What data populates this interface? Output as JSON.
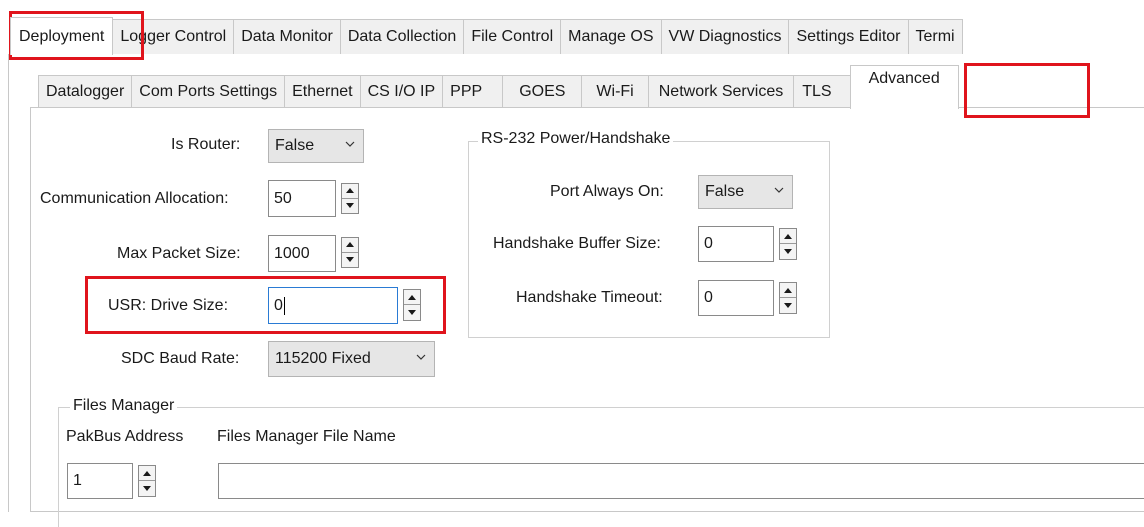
{
  "main_tabs": [
    "Deployment",
    "Logger Control",
    "Data Monitor",
    "Data Collection",
    "File Control",
    "Manage OS",
    "VW Diagnostics",
    "Settings Editor",
    "Termi"
  ],
  "sub_tabs": [
    "Datalogger",
    "Com Ports Settings",
    "Ethernet",
    "CS I/O IP",
    "PPP",
    "GOES",
    "Wi-Fi",
    "Network Services",
    "TLS",
    "Advanced"
  ],
  "fields": {
    "is_router": {
      "label": "Is Router:",
      "value": "False"
    },
    "comm_alloc": {
      "label": "Communication Allocation:",
      "value": "50"
    },
    "max_packet": {
      "label": "Max Packet Size:",
      "value": "1000"
    },
    "usr_drive": {
      "label": "USR: Drive Size:",
      "value": "0"
    },
    "sdc_baud": {
      "label": "SDC Baud Rate:",
      "value": "115200 Fixed"
    }
  },
  "rs232": {
    "title": "RS-232 Power/Handshake",
    "port_always_on": {
      "label": "Port Always On:",
      "value": "False"
    },
    "handshake_buffer": {
      "label": "Handshake Buffer Size:",
      "value": "0"
    },
    "handshake_timeout": {
      "label": "Handshake Timeout:",
      "value": "0"
    }
  },
  "files_manager": {
    "title": "Files Manager",
    "col_pakbus": "PakBus Address",
    "col_filename": "Files Manager File Name",
    "pakbus_value": "1",
    "filename_value": ""
  },
  "colors": {
    "highlight": "#e0141c",
    "focus_border": "#2a7bd4"
  }
}
